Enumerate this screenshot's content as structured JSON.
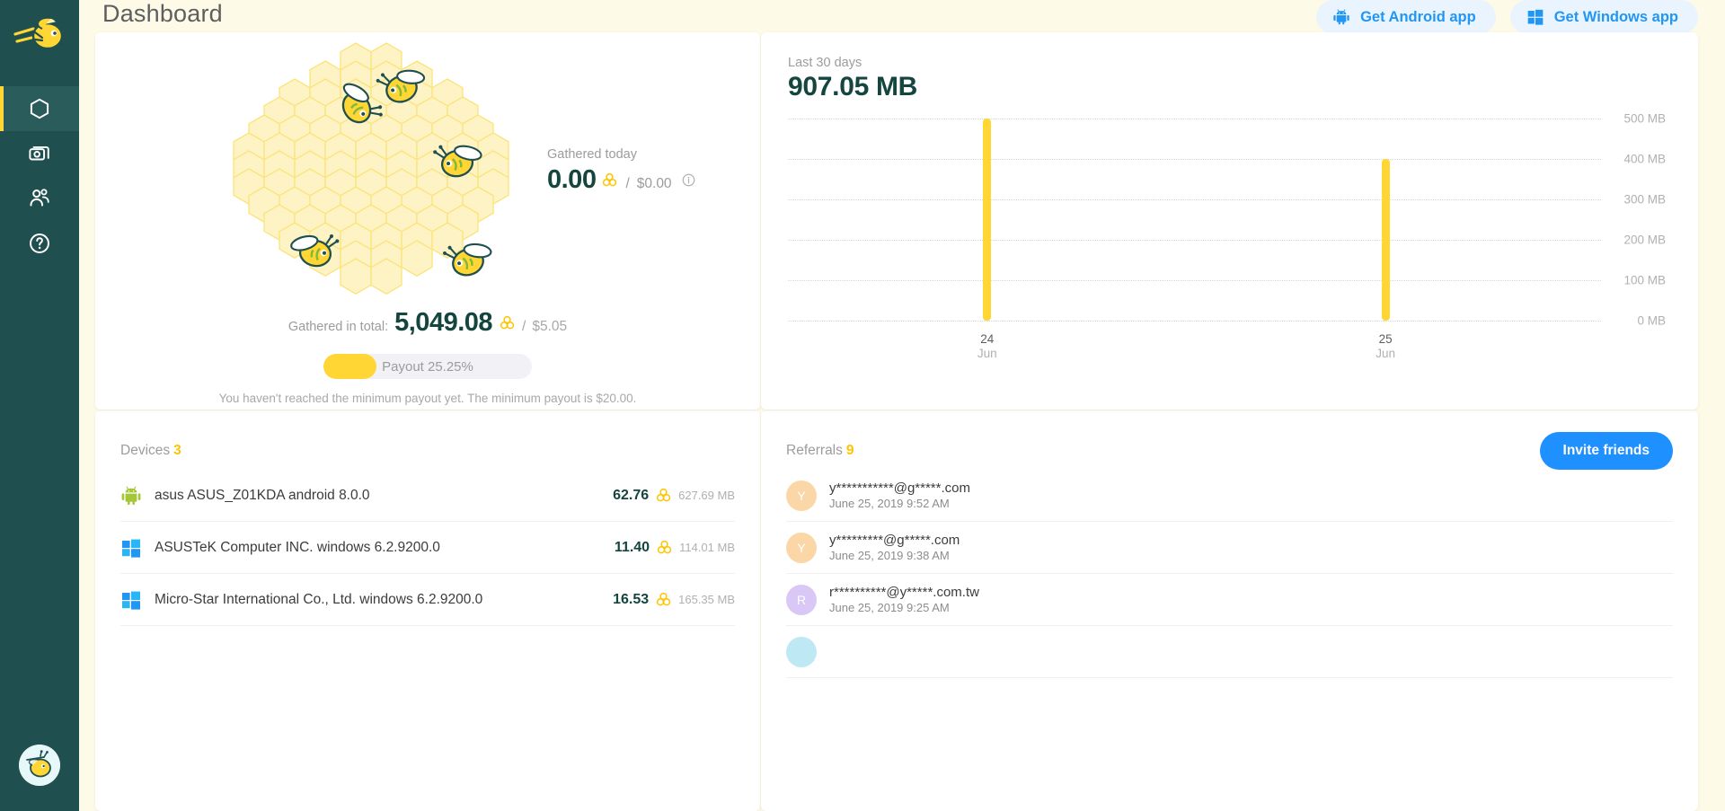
{
  "sidebar": {
    "logo_icon": "bee-logo",
    "items": [
      {
        "icon": "hexagon-icon",
        "name": "dashboard",
        "active": true
      },
      {
        "icon": "money-icon",
        "name": "payouts",
        "active": false
      },
      {
        "icon": "people-icon",
        "name": "referrals",
        "active": false
      },
      {
        "icon": "help-icon",
        "name": "help",
        "active": false
      }
    ],
    "avatar_icon": "bee-avatar"
  },
  "header": {
    "title": "Dashboard",
    "actions": [
      {
        "label": "Get Android app",
        "icon": "android-icon"
      },
      {
        "label": "Get Windows app",
        "icon": "windows-icon"
      }
    ],
    "accent_color": "#2196f3",
    "pill_bg": "#eaf4ff"
  },
  "hive": {
    "illustration": "honeycomb-with-bees",
    "gathered_today_label": "Gathered today",
    "gathered_today_value": "0.00",
    "gathered_today_slash": "/",
    "gathered_today_usd": "$0.00",
    "info_icon": "info-icon",
    "honey_icon": "honey-icon",
    "total_label": "Gathered in total:",
    "total_value": "5,049.08",
    "total_slash": "/",
    "total_usd": "$5.05",
    "payout_text": "Payout 25.25%",
    "payout_percent": 25.25,
    "payout_note": "You haven't reached the minimum payout yet. The minimum payout is $20.00.",
    "bar_color": "#ffd633",
    "track_color": "#f2f1f6"
  },
  "chart_data": {
    "type": "bar",
    "title": "907.05 MB",
    "subtitle": "Last 30 days",
    "categories": [
      "24 Jun",
      "25 Jun"
    ],
    "x_day": [
      "24",
      "25"
    ],
    "x_month": [
      "Jun",
      "Jun"
    ],
    "values": [
      500,
      400
    ],
    "value_labels": [
      "500 MB",
      "400 MB"
    ],
    "ylabel": "",
    "xlabel": "",
    "ylim": [
      0,
      500
    ],
    "yticks": [
      0,
      100,
      200,
      300,
      400,
      500
    ],
    "ytick_labels": [
      "0 MB",
      "100 MB",
      "200 MB",
      "300 MB",
      "400 MB",
      "500 MB"
    ],
    "grid": true,
    "legend": "none",
    "bar_color": "#ffd633",
    "x_positions_pct": [
      24.5,
      73.5
    ]
  },
  "devices": {
    "title": "Devices",
    "count": "3",
    "items": [
      {
        "icon": "android-icon",
        "name": "asus ASUS_Z01KDA android 8.0.0",
        "value": "62.76",
        "honey_icon": "honey-icon",
        "traffic": "627.69 MB"
      },
      {
        "icon": "windows-icon",
        "name": "ASUSTeK Computer INC. windows 6.2.9200.0",
        "value": "11.40",
        "honey_icon": "honey-icon",
        "traffic": "114.01 MB"
      },
      {
        "icon": "windows-icon",
        "name": "Micro-Star International Co., Ltd. windows 6.2.9200.0",
        "value": "16.53",
        "honey_icon": "honey-icon",
        "traffic": "165.35 MB"
      }
    ]
  },
  "referrals": {
    "title": "Referrals",
    "count": "9",
    "invite_label": "Invite friends",
    "items": [
      {
        "initial": "Y",
        "color": "#fbd7a8",
        "email": "y***********@g*****.com",
        "date": "June 25, 2019 9:52 AM"
      },
      {
        "initial": "Y",
        "color": "#fbd7a8",
        "email": "y*********@g*****.com",
        "date": "June 25, 2019 9:38 AM"
      },
      {
        "initial": "R",
        "color": "#d9c8f5",
        "email": "r**********@y*****.com.tw",
        "date": "June 25, 2019 9:25 AM"
      },
      {
        "initial": "",
        "color": "#bfe8f5",
        "email": "",
        "date": ""
      }
    ]
  }
}
